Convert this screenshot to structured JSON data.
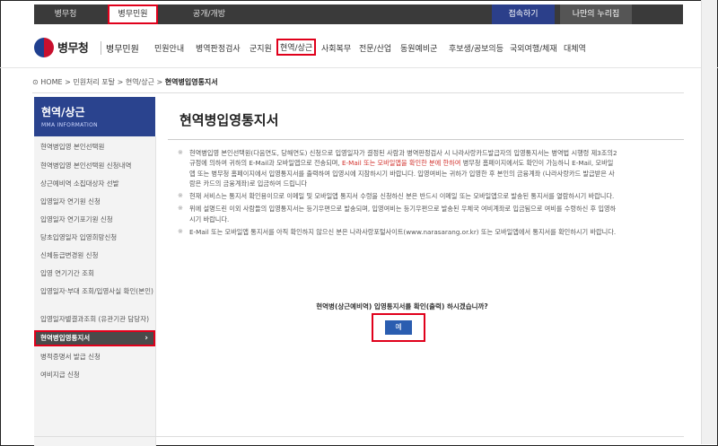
{
  "topbar": {
    "tab1": "병무청",
    "tab2": "병무민원",
    "tab3": "공개/개방",
    "right1": "접속하기",
    "right2": "나만의 누리집"
  },
  "header": {
    "logo_name": "병무청",
    "logo_sub": "병무민원",
    "nav": [
      "민원안내",
      "병역판정검사",
      "군지원",
      "현역/상근",
      "사회복무",
      "전문/산업",
      "동원예비군",
      "후보생/공보의등",
      "국외여행/체재",
      "대체역"
    ]
  },
  "breadcrumb": {
    "home": "HOME",
    "sep": ">",
    "c1": "민원처리 포탈",
    "c2": "현역/상근",
    "c3": "현역병입영통지서"
  },
  "sidebar": {
    "title": "현역/상근",
    "subtitle": "MMA INFORMATION",
    "items": [
      "현역병입영 본인선택원",
      "현역병입영 본인선택원 신청내역",
      "상근예비역 소집대상자 선발",
      "입영일자 연기원 신청",
      "입영일자 연기포기원 신청",
      "당초입영일자 입영희망신청",
      "신체등급변경원 신청",
      "입영 연기기간 조회",
      "입영일자·부대 조회/입영사실 확인(본인)",
      "입영일자별결과조회 (유관기관 담당자)",
      "현역병입영통지서",
      "병적증명서 발급 신청",
      "여비지급 신청"
    ],
    "active_arrow": "›"
  },
  "main": {
    "title": "현역병입영통지서",
    "notes": [
      {
        "pre": "현역병입영 본인선택원(다음연도, 당해연도) 신청으로 입영일자가 결정된 사람과 병역판정검사 시 나라사랑카드발급자의 입영통지서는 병역법 시행령 제3조의2규정에 의하여 귀하의 E-Mail과 모바일앱으로 전송되며, ",
        "red": "E-Mail 또는 모바일앱을 확인한 분에 한하여",
        "post": " 병무청 홈페이지에서도 확인이 가능하니 E-Mail, 모바일앱 또는 병무청 홈페이지에서 입영통지서를 출력하여 입영시에 지참하시기 바랍니다. 입영여비는 귀하가 입영한 후 본인의 금융계좌 (나라사랑카드 발급받은 사람은 카드의 금융계좌)로 입금하여 드립니다"
      },
      {
        "pre": "현재 서비스는 통지서 확인용이므로 이메일 및 모바일앱 통지서 수령을 신청하신 분은 반드시 이메일 또는 모바일앱으로 발송된 통지서를 열람하시기 바랍니다.",
        "red": "",
        "post": ""
      },
      {
        "pre": "위에 설명드린 이외 사람들의 입영통지서는 등기우편으로 발송되며, 입영여비는 등기우편으로 발송된 우체국 여비계좌로 입금됨으로 여비를 수령하신 후 입영하시기 바랍니다.",
        "red": "",
        "post": ""
      },
      {
        "pre": "E-Mail 또는 모바일앱 통지서를 아직 확인하지 않으신 분은 나라사랑포털사이트(www.narasarang.or.kr) 또는 모바일앱에서 통지서를 확인하시기 바랍니다.",
        "red": "",
        "post": ""
      }
    ],
    "note_mark": "※",
    "question": "현역병(상근예비역) 입영통지서를 확인(출력) 하시겠습니까?",
    "yes_label": "예"
  },
  "colors": {
    "accent": "#2a438e",
    "highlight": "#e0001b",
    "button": "#2a5db0"
  }
}
